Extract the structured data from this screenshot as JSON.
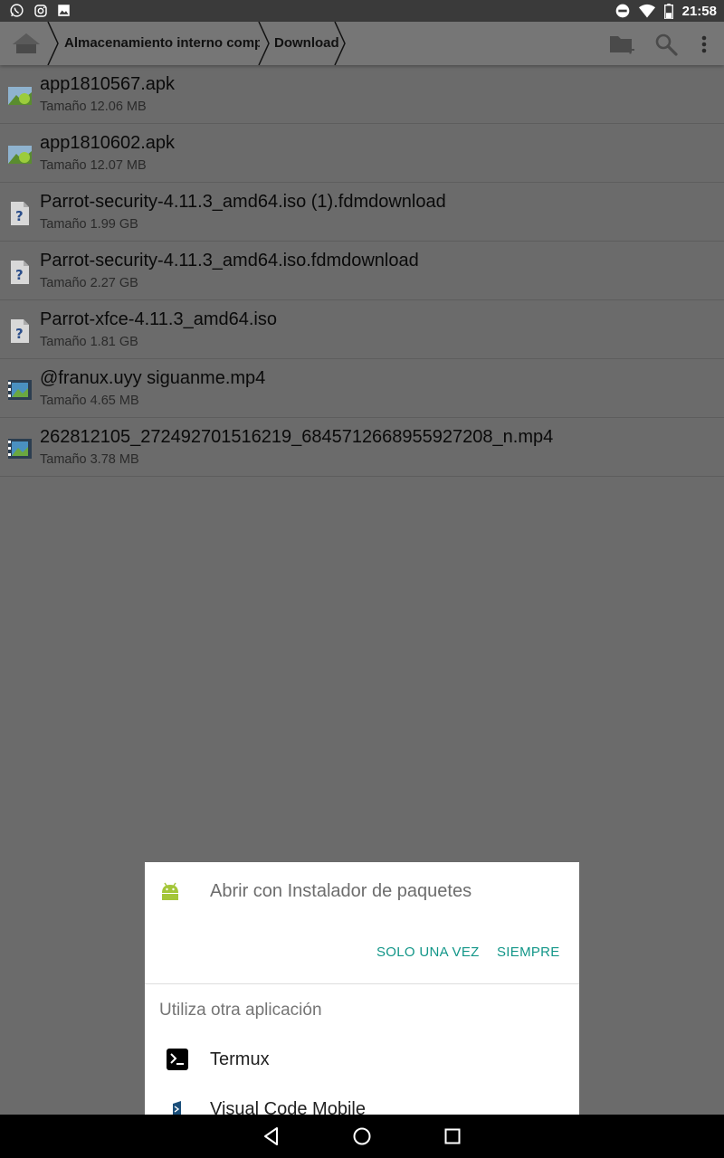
{
  "status_bar": {
    "time": "21:58",
    "left_icons": [
      "whatsapp-icon",
      "instagram-icon",
      "gallery-icon"
    ],
    "right_icons": [
      "do-not-disturb-icon",
      "wifi-icon",
      "battery-icon"
    ]
  },
  "toolbar": {
    "home_icon": "home-icon",
    "breadcrumbs": [
      {
        "label": "Almacenamiento interno compartido"
      },
      {
        "label": "Download"
      }
    ],
    "actions": [
      "new-folder-icon",
      "search-icon",
      "more-vert-icon"
    ]
  },
  "files": [
    {
      "name": "app1810567.apk",
      "size": "Tamaño 12.06 MB",
      "icon": "apk-file-icon"
    },
    {
      "name": "app1810602.apk",
      "size": "Tamaño 12.07 MB",
      "icon": "apk-file-icon"
    },
    {
      "name": "Parrot-security-4.11.3_amd64.iso (1).fdmdownload",
      "size": "Tamaño 1.99 GB",
      "icon": "unknown-file-icon"
    },
    {
      "name": "Parrot-security-4.11.3_amd64.iso.fdmdownload",
      "size": "Tamaño 2.27 GB",
      "icon": "unknown-file-icon"
    },
    {
      "name": "Parrot-xfce-4.11.3_amd64.iso",
      "size": "Tamaño 1.81 GB",
      "icon": "unknown-file-icon"
    },
    {
      "name": "@franux.uyy  siguanme.mp4",
      "size": "Tamaño 4.65 MB",
      "icon": "video-file-icon"
    },
    {
      "name": "262812105_272492701516219_6845712668955927208_n.mp4",
      "size": "Tamaño 3.78 MB",
      "icon": "video-file-icon"
    }
  ],
  "dialog": {
    "title": "Abrir con Instalador de paquetes",
    "app_icon": "android-icon",
    "once_label": "SOLO UNA VEZ",
    "always_label": "SIEMPRE",
    "other_label": "Utiliza otra aplicación",
    "apps": [
      {
        "label": "Termux",
        "icon": "termux-icon"
      },
      {
        "label": "Visual Code Mobile",
        "icon": "visual-code-mobile-icon"
      }
    ],
    "accent_color": "#129688"
  },
  "nav_bar": {
    "buttons": [
      "back-icon",
      "home-circle-icon",
      "recents-icon"
    ]
  }
}
